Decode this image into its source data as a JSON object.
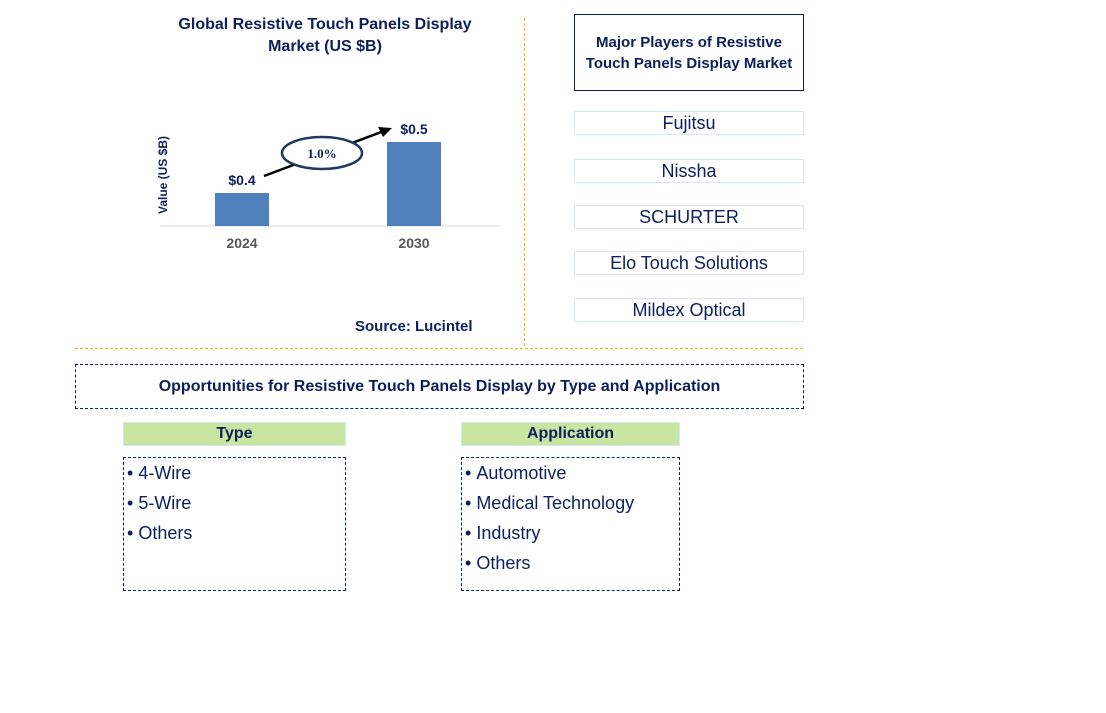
{
  "chart_data": {
    "type": "bar",
    "title": "Global Resistive Touch Panels Display Market (US $B)",
    "title_lines": [
      "Global Resistive Touch Panels Display",
      "Market (US $B)"
    ],
    "categories": [
      "2024",
      "2030"
    ],
    "values": [
      0.4,
      0.5
    ],
    "data_labels": [
      "$0.4",
      "$0.5"
    ],
    "ylabel": "Value (US $B)",
    "xlabel": "",
    "ylim": [
      0,
      0.6
    ],
    "grid": false,
    "bar_color": "#4f81bd",
    "annotation": {
      "type": "cagr-arrow",
      "label": "1.0%"
    },
    "source": "Source: Lucintel"
  },
  "players": {
    "title": "Major Players of Resistive Touch Panels Display Market",
    "items": [
      "Fujitsu",
      "Nissha",
      "SCHURTER",
      "Elo Touch Solutions",
      "Mildex Optical"
    ]
  },
  "opportunities": {
    "title": "Opportunities for Resistive Touch Panels Display by Type and Application",
    "type": {
      "heading": "Type",
      "items": [
        "4-Wire",
        "5-Wire",
        "Others"
      ]
    },
    "application": {
      "heading": "Application",
      "items": [
        "Automotive",
        "Medical Technology",
        "Industry",
        "Others"
      ]
    }
  },
  "colors": {
    "text": "#0c1f5c",
    "bar": "#4f81bd",
    "divider": "#f5b800",
    "category_header": "#c8e6a0",
    "player_border": "#d4e6f2"
  }
}
